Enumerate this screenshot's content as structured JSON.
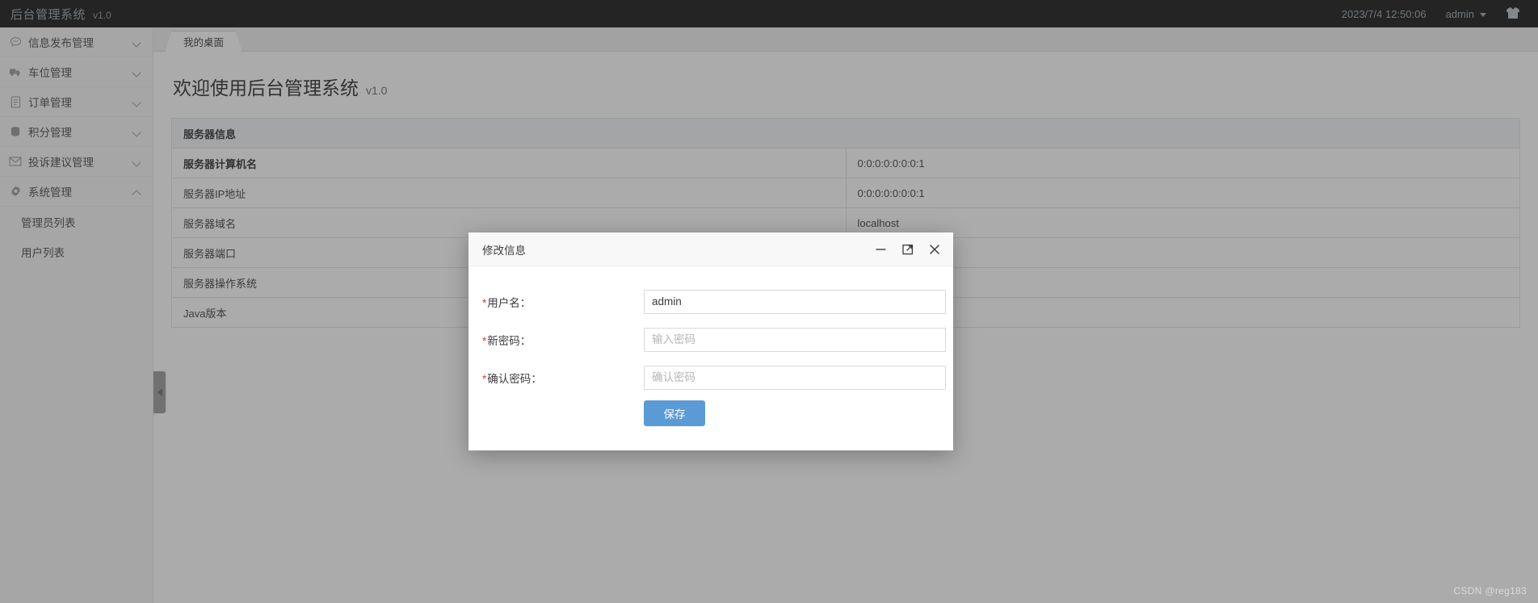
{
  "header": {
    "brand_title": "后台管理系统",
    "brand_version": "v1.0",
    "datetime": "2023/7/4 12:50:06",
    "user": "admin",
    "user_caret_icon": "chevron-down-icon",
    "shirt_icon": "shirt-icon"
  },
  "sidebar": {
    "groups": [
      {
        "label": "信息发布管理",
        "icon": "speech-bubble-icon",
        "expanded": false
      },
      {
        "label": "车位管理",
        "icon": "truck-icon",
        "expanded": false
      },
      {
        "label": "订单管理",
        "icon": "document-icon",
        "expanded": false
      },
      {
        "label": "积分管理",
        "icon": "database-icon",
        "expanded": false
      },
      {
        "label": "投诉建议管理",
        "icon": "envelope-icon",
        "expanded": false
      },
      {
        "label": "系统管理",
        "icon": "gear-icon",
        "expanded": true
      }
    ],
    "system_children": [
      {
        "label": "管理员列表"
      },
      {
        "label": "用户列表"
      }
    ],
    "collapse_handle_icon": "chevron-left-icon"
  },
  "tabs": [
    {
      "label": "我的桌面",
      "active": true
    }
  ],
  "main": {
    "welcome_title": "欢迎使用后台管理系统",
    "welcome_version": "v1.0",
    "table": {
      "section_title": "服务器信息",
      "rows": [
        {
          "key": "服务器计算机名",
          "value": "0:0:0:0:0:0:0:1"
        },
        {
          "key": "服务器IP地址",
          "value": "0:0:0:0:0:0:0:1"
        },
        {
          "key": "服务器域名",
          "value": "localhost"
        },
        {
          "key": "服务器端口",
          "value": ""
        },
        {
          "key": "服务器操作系统",
          "value": ""
        },
        {
          "key": "Java版本",
          "value": ""
        }
      ]
    }
  },
  "modal": {
    "title": "修改信息",
    "minimize_icon": "minimize-icon",
    "maximize_icon": "maximize-icon",
    "close_icon": "close-icon",
    "fields": [
      {
        "label": "用户名：",
        "required": true,
        "value": "admin",
        "placeholder": ""
      },
      {
        "label": "新密码：",
        "required": true,
        "value": "",
        "placeholder": "输入密码"
      },
      {
        "label": "确认密码：",
        "required": true,
        "value": "",
        "placeholder": "确认密码"
      }
    ],
    "save_label": "保存",
    "accent_color": "#5b9bd5"
  },
  "watermark": "CSDN @reg183"
}
